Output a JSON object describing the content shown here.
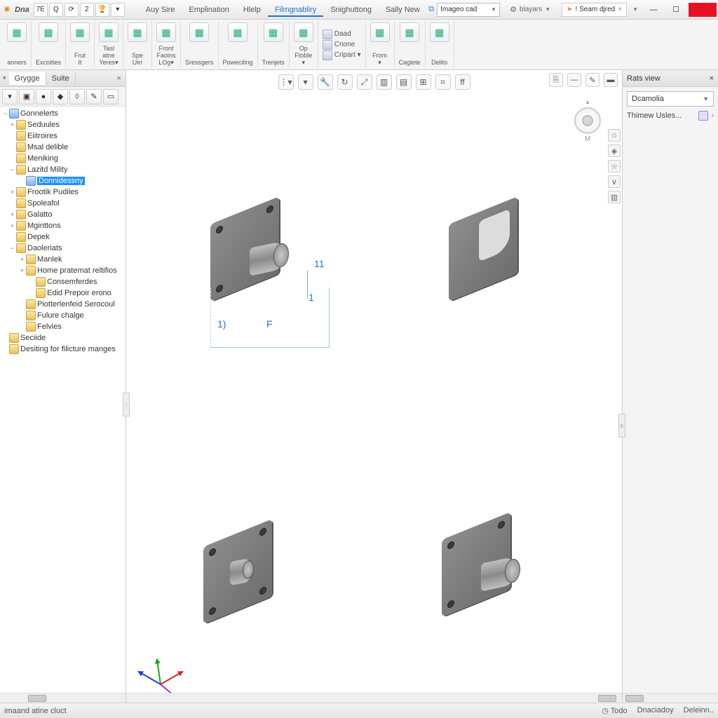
{
  "app": {
    "name": "Dna"
  },
  "qat": [
    "7E",
    "Q",
    "⟳",
    "2",
    "🏆",
    "▾"
  ],
  "menu": {
    "items": [
      "Auy Sire",
      "Emplination",
      "Hlelp",
      "Filmgnabliry",
      "Snighuttong",
      "Sally New"
    ],
    "active_index": 3
  },
  "title_controls": {
    "doc_combo": "Imageo cad",
    "layers_label": "blayars",
    "search_chip": "! Seam djred"
  },
  "ribbon": {
    "groups": [
      {
        "label": "anners"
      },
      {
        "label": "Excoities"
      },
      {
        "label": "Frut\nIt"
      },
      {
        "label": "Tasl\natne\nYeres▾"
      },
      {
        "label": "Spe\nUirr"
      },
      {
        "label": "Front\nFaoins\nLOg▾"
      },
      {
        "label": "Sressgers"
      },
      {
        "label": "Poweciling"
      },
      {
        "label": "Trenjets"
      },
      {
        "label": "Op\nFtoble\n▾"
      }
    ],
    "stack1": [
      "Daad",
      "Cnone",
      "Cripart ▾"
    ],
    "groups2": [
      {
        "label": "From\n▾"
      },
      {
        "label": "Caglete"
      },
      {
        "label": "Delito"
      }
    ]
  },
  "left_panel": {
    "tabs": [
      "Grygge",
      "Suite"
    ],
    "toolbar_count": 7,
    "tree": [
      {
        "d": 0,
        "exp": "−",
        "icon": "blue",
        "label": "Gonnelerts"
      },
      {
        "d": 1,
        "exp": "+",
        "icon": "y",
        "label": "Seduules"
      },
      {
        "d": 1,
        "exp": "",
        "icon": "y",
        "label": "Eiitroires"
      },
      {
        "d": 1,
        "exp": "",
        "icon": "y",
        "label": "Msal delible"
      },
      {
        "d": 1,
        "exp": "",
        "icon": "y",
        "label": "Meniking"
      },
      {
        "d": 1,
        "exp": "−",
        "icon": "y",
        "label": "Lazitd Mility"
      },
      {
        "d": 2,
        "exp": "",
        "icon": "blue",
        "label": "Donnidessny",
        "selected": true
      },
      {
        "d": 1,
        "exp": "+",
        "icon": "y",
        "label": "Frootik Pudiles"
      },
      {
        "d": 1,
        "exp": "",
        "icon": "y",
        "label": "Spoleafol"
      },
      {
        "d": 1,
        "exp": "+",
        "icon": "y",
        "label": "Galatto"
      },
      {
        "d": 1,
        "exp": "+",
        "icon": "y",
        "label": "Mginttons"
      },
      {
        "d": 1,
        "exp": "",
        "icon": "y",
        "label": "Depek"
      },
      {
        "d": 1,
        "exp": "−",
        "icon": "y",
        "label": "Daoleriats"
      },
      {
        "d": 2,
        "exp": "+",
        "icon": "y",
        "label": "Manlek"
      },
      {
        "d": 2,
        "exp": "+",
        "icon": "y",
        "label": "Home pratemat reltifios"
      },
      {
        "d": 3,
        "exp": "",
        "icon": "y",
        "label": "Consemferdes"
      },
      {
        "d": 3,
        "exp": "",
        "icon": "y",
        "label": "Edid Prepoir erono"
      },
      {
        "d": 2,
        "exp": "",
        "icon": "y",
        "label": "Piotterlenfeid Serocoul"
      },
      {
        "d": 2,
        "exp": "",
        "icon": "y",
        "label": "Fulure chalge"
      },
      {
        "d": 2,
        "exp": "",
        "icon": "y",
        "label": "Felvies"
      },
      {
        "d": 0,
        "exp": "",
        "icon": "y",
        "label": "Seciide"
      },
      {
        "d": 0,
        "exp": "",
        "icon": "y",
        "label": "Desiting for filicture manges"
      }
    ]
  },
  "viewport": {
    "top_tools_count": 10,
    "right_tools_count": 4,
    "navcube_label": "M",
    "side_icons": [
      "⌂",
      "◈",
      "☆",
      "∨",
      "▥"
    ],
    "dims": {
      "a": "11",
      "b": "1",
      "c": "1)",
      "d": "F"
    },
    "splitter_right_label": "c"
  },
  "right_panel": {
    "title": "Rats view",
    "combo": "Dcamolia",
    "row1": "Thimew Usles..."
  },
  "status": {
    "left": "imaand atine cluct",
    "items": [
      "Todo",
      "Dnaciadoy",
      "Deleinn.."
    ]
  }
}
